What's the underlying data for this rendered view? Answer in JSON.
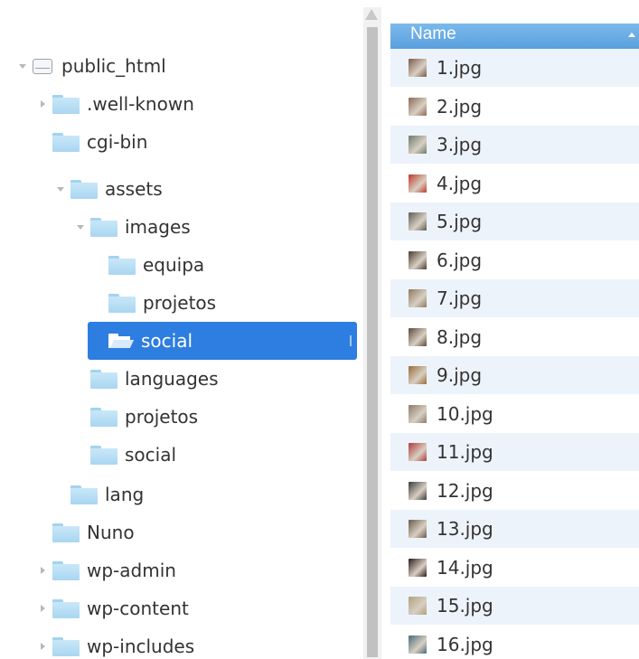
{
  "tree": {
    "nodes": [
      {
        "label": "public_html",
        "type": "drive",
        "expanded": true
      },
      {
        "label": ".well-known",
        "type": "folder",
        "expandable": true
      },
      {
        "label": "cgi-bin",
        "type": "folder"
      },
      {
        "label": "assets",
        "type": "folder",
        "expanded": true
      },
      {
        "label": "images",
        "type": "folder",
        "expanded": true
      },
      {
        "label": "equipa",
        "type": "folder"
      },
      {
        "label": "projetos",
        "type": "folder"
      },
      {
        "label": "social",
        "type": "folder",
        "selected": true
      },
      {
        "label": "languages",
        "type": "folder"
      },
      {
        "label": "projetos",
        "type": "folder"
      },
      {
        "label": "social",
        "type": "folder"
      },
      {
        "label": "lang",
        "type": "folder"
      },
      {
        "label": "Nuno",
        "type": "folder"
      },
      {
        "label": "wp-admin",
        "type": "folder",
        "expandable": true
      },
      {
        "label": "wp-content",
        "type": "folder",
        "expandable": true
      },
      {
        "label": "wp-includes",
        "type": "folder",
        "expandable": true
      }
    ]
  },
  "file_list": {
    "header": {
      "name_label": "Name",
      "sort": "ascending"
    },
    "files": [
      {
        "name": "1.jpg",
        "thumb_color": "#7a5a4a"
      },
      {
        "name": "2.jpg",
        "thumb_color": "#8a6a5a"
      },
      {
        "name": "3.jpg",
        "thumb_color": "#6f7a6a"
      },
      {
        "name": "4.jpg",
        "thumb_color": "#c0392b"
      },
      {
        "name": "5.jpg",
        "thumb_color": "#5d5a55"
      },
      {
        "name": "6.jpg",
        "thumb_color": "#4a3a30"
      },
      {
        "name": "7.jpg",
        "thumb_color": "#8c7a5c"
      },
      {
        "name": "8.jpg",
        "thumb_color": "#5a4a3a"
      },
      {
        "name": "9.jpg",
        "thumb_color": "#9a6a3a"
      },
      {
        "name": "10.jpg",
        "thumb_color": "#8a7a6a"
      },
      {
        "name": "11.jpg",
        "thumb_color": "#b03a3a"
      },
      {
        "name": "12.jpg",
        "thumb_color": "#3a3a3a"
      },
      {
        "name": "13.jpg",
        "thumb_color": "#6a5a4a"
      },
      {
        "name": "14.jpg",
        "thumb_color": "#2a1a1a"
      },
      {
        "name": "15.jpg",
        "thumb_color": "#b0a080"
      },
      {
        "name": "16.jpg",
        "thumb_color": "#4a6a7a"
      }
    ]
  },
  "colors": {
    "selection": "#2e7de0",
    "header": "#5aa0de",
    "alt_row": "#edf3fb"
  }
}
